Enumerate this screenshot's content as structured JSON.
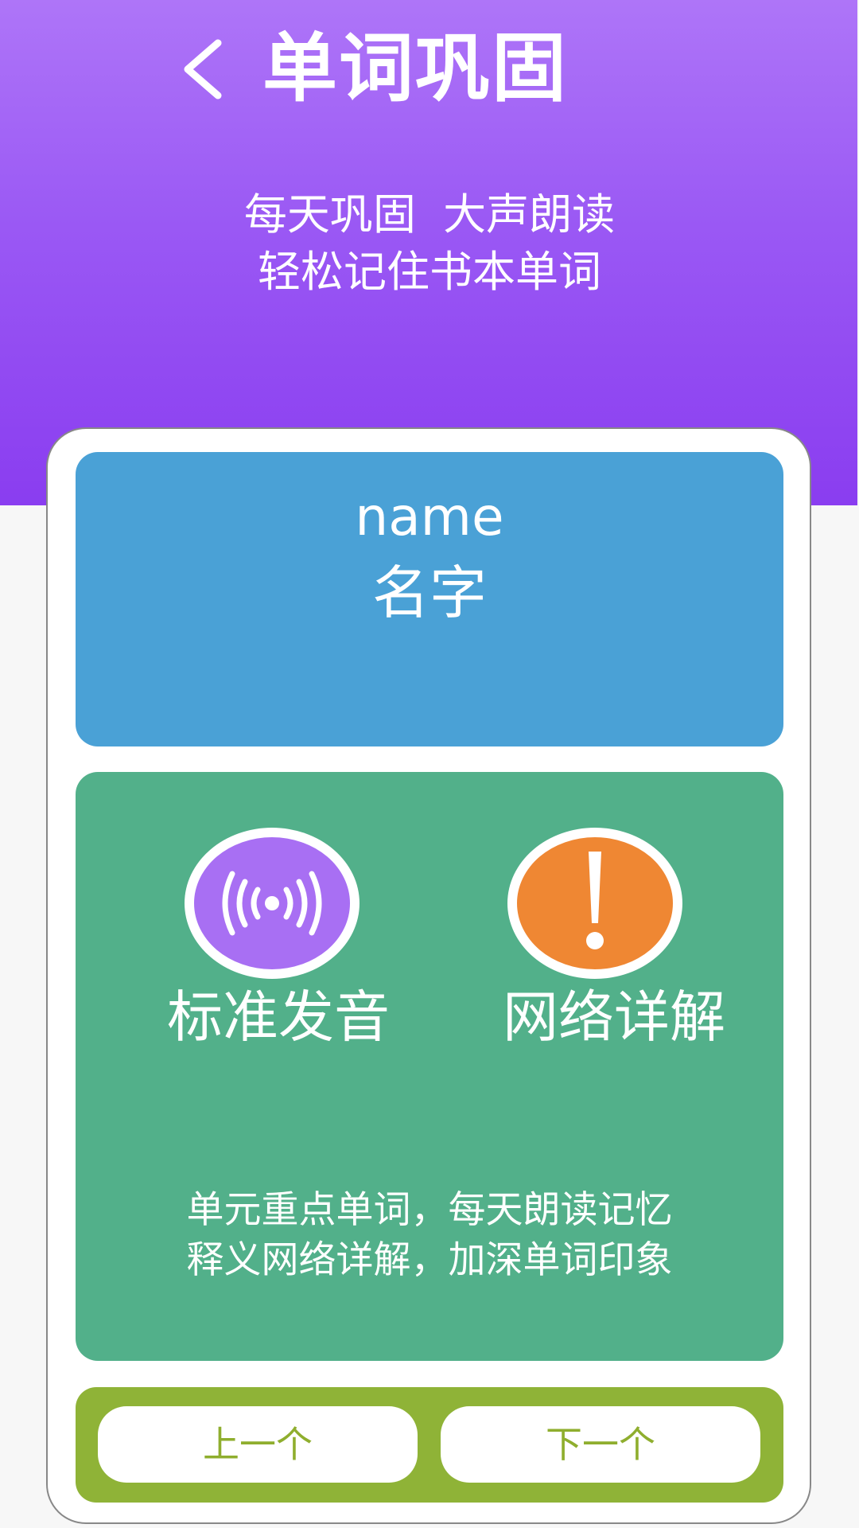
{
  "header": {
    "title": "单词巩固",
    "subtitle_line1": "每天巩固  大声朗读",
    "subtitle_line2": "轻松记住书本单词",
    "back_icon": "chevron-left-icon",
    "gradient_top": "#ae75f8",
    "gradient_bottom": "#8a3df0"
  },
  "word": {
    "english": "name",
    "chinese": "名字",
    "panel_color": "#4aa1d6"
  },
  "actions": {
    "panel_color": "#52b08a",
    "pronounce": {
      "label": "标准发音",
      "icon": "sound-wave-icon",
      "color": "#a86ff3"
    },
    "details": {
      "label": "网络详解",
      "icon": "exclamation-icon",
      "color": "#ef8733"
    },
    "description_line1": "单元重点单词，每天朗读记忆",
    "description_line2": "释义网络详解，加深单词印象"
  },
  "navigation": {
    "bar_color": "#8fb337",
    "prev_label": "上一个",
    "next_label": "下一个"
  }
}
